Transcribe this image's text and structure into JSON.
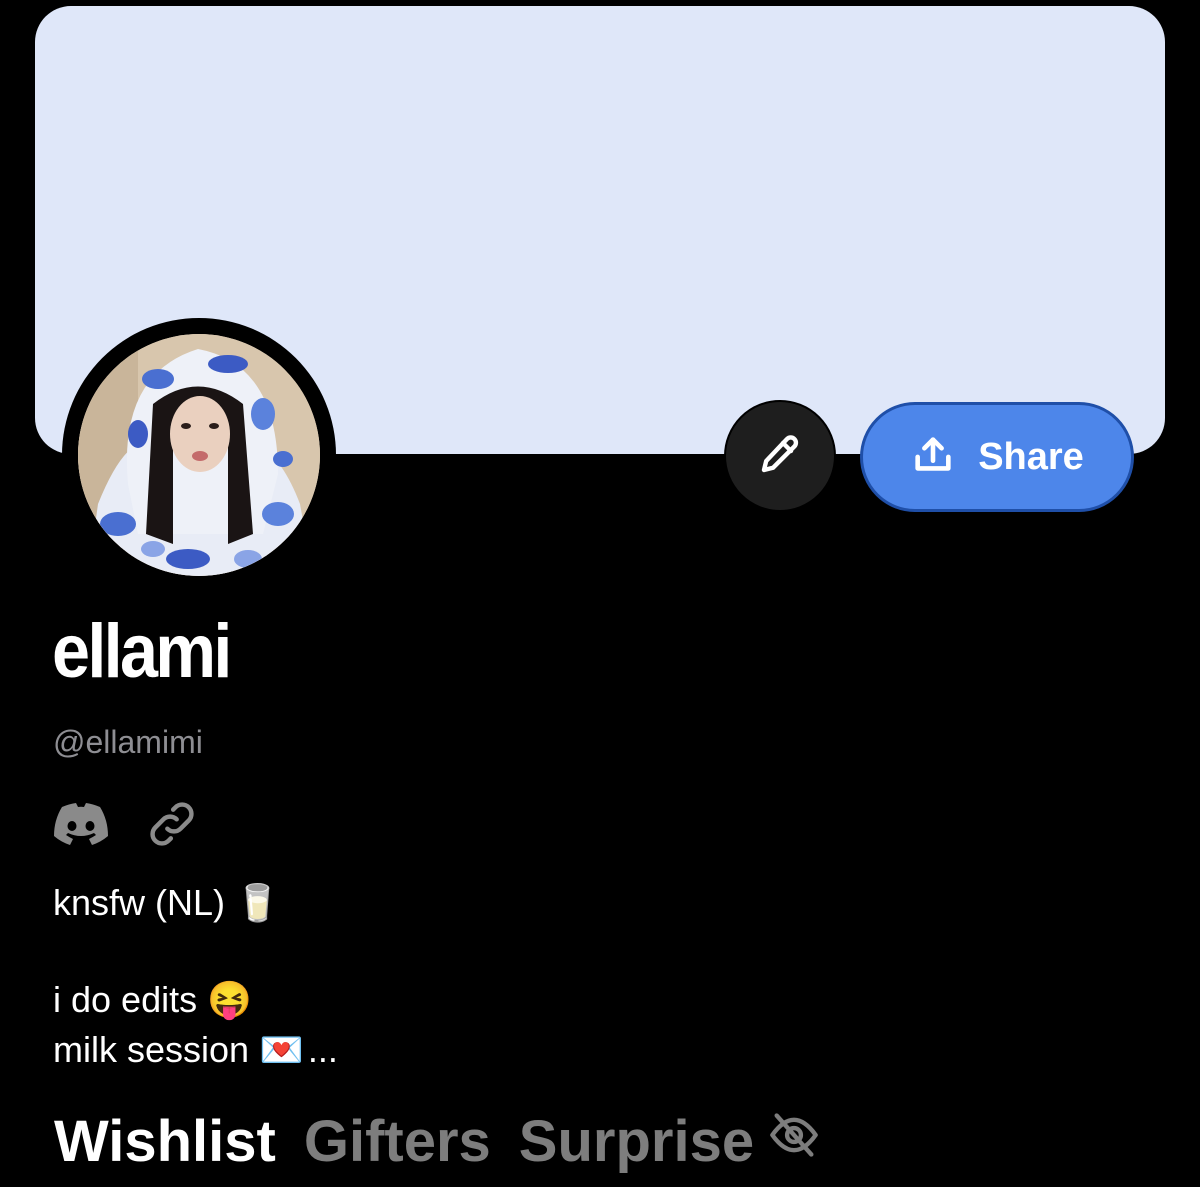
{
  "profile": {
    "display_name": "ellami",
    "handle": "@ellamimi",
    "avatar_desc": "profile-photo"
  },
  "actions": {
    "edit_icon": "pencil-icon",
    "share_label": "Share",
    "share_icon": "share-upload-icon"
  },
  "links": [
    {
      "icon": "discord-icon"
    },
    {
      "icon": "link-icon"
    }
  ],
  "bio": {
    "line1": "knsfw (NL)",
    "line1_emoji": "🥛",
    "line2": "i do edits",
    "line2_emoji": "😝",
    "line3": "milk session",
    "line3_emoji": "💌",
    "line3_suffix": "..."
  },
  "tabs": [
    {
      "label": "Wishlist",
      "active": true
    },
    {
      "label": "Gifters",
      "active": false
    },
    {
      "label": "Surprise",
      "active": false,
      "icon": "eye-off-icon"
    }
  ],
  "colors": {
    "background": "#000000",
    "banner": "#dfe7f9",
    "accent": "#4d86ea",
    "muted_text": "#8e8e93",
    "inactive_tab": "#7d7d7d"
  }
}
